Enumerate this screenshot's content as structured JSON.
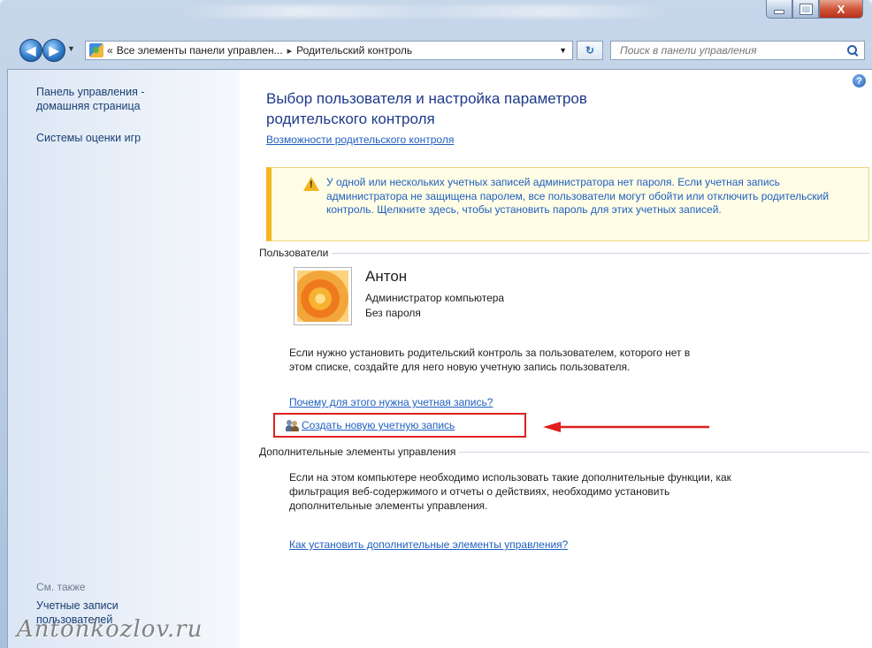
{
  "window": {
    "caption_buttons": {
      "minimize_icon": "minimize-icon",
      "maximize_icon": "maximize-icon",
      "close_label": "X"
    }
  },
  "navigation": {
    "back_icon": "back-arrow-icon",
    "forward_icon": "forward-arrow-icon",
    "breadcrumb_prefix": "«",
    "breadcrumb": [
      "Все элементы панели управлен...",
      "Родительский контроль"
    ],
    "breadcrumb_separator": "▸",
    "search_placeholder": "Поиск в панели управления"
  },
  "sidebar": {
    "home_link": "Панель управления - домашняя страница",
    "game_ratings_link": "Системы оценки игр",
    "see_also_label": "См. также",
    "user_accounts_link": "Учетные записи пользователей"
  },
  "main": {
    "title": "Выбор пользователя и настройка параметров родительского контроля",
    "features_link": "Возможности родительского контроля",
    "warning_text": "У одной или нескольких учетных записей администратора нет пароля. Если учетная запись администратора не защищена паролем, все пользователи могут обойти или отключить родительский контроль. Щелкните здесь, чтобы установить пароль для этих учетных записей.",
    "users_section": "Пользователи",
    "user": {
      "name": "Антон",
      "role": "Администратор компьютера",
      "password_status": "Без пароля"
    },
    "new_user_text": "Если нужно установить родительский контроль за пользователем, которого нет в этом списке, создайте для него новую учетную запись пользователя.",
    "why_link": "Почему для этого нужна учетная запись?",
    "create_account_link": "Создать новую учетную запись",
    "additional_section": "Дополнительные элементы управления",
    "additional_text": "Если на этом компьютере необходимо использовать такие дополнительные функции, как фильтрация веб-содержимого и отчеты о действиях, необходимо установить дополнительные элементы управления.",
    "install_link": "Как установить дополнительные элементы управления?"
  },
  "watermark": "Antonkozlov.ru",
  "colors": {
    "accent": "#1f5fbf",
    "highlight_box": "#e01f1f",
    "warning_bar": "#f4b51d"
  }
}
